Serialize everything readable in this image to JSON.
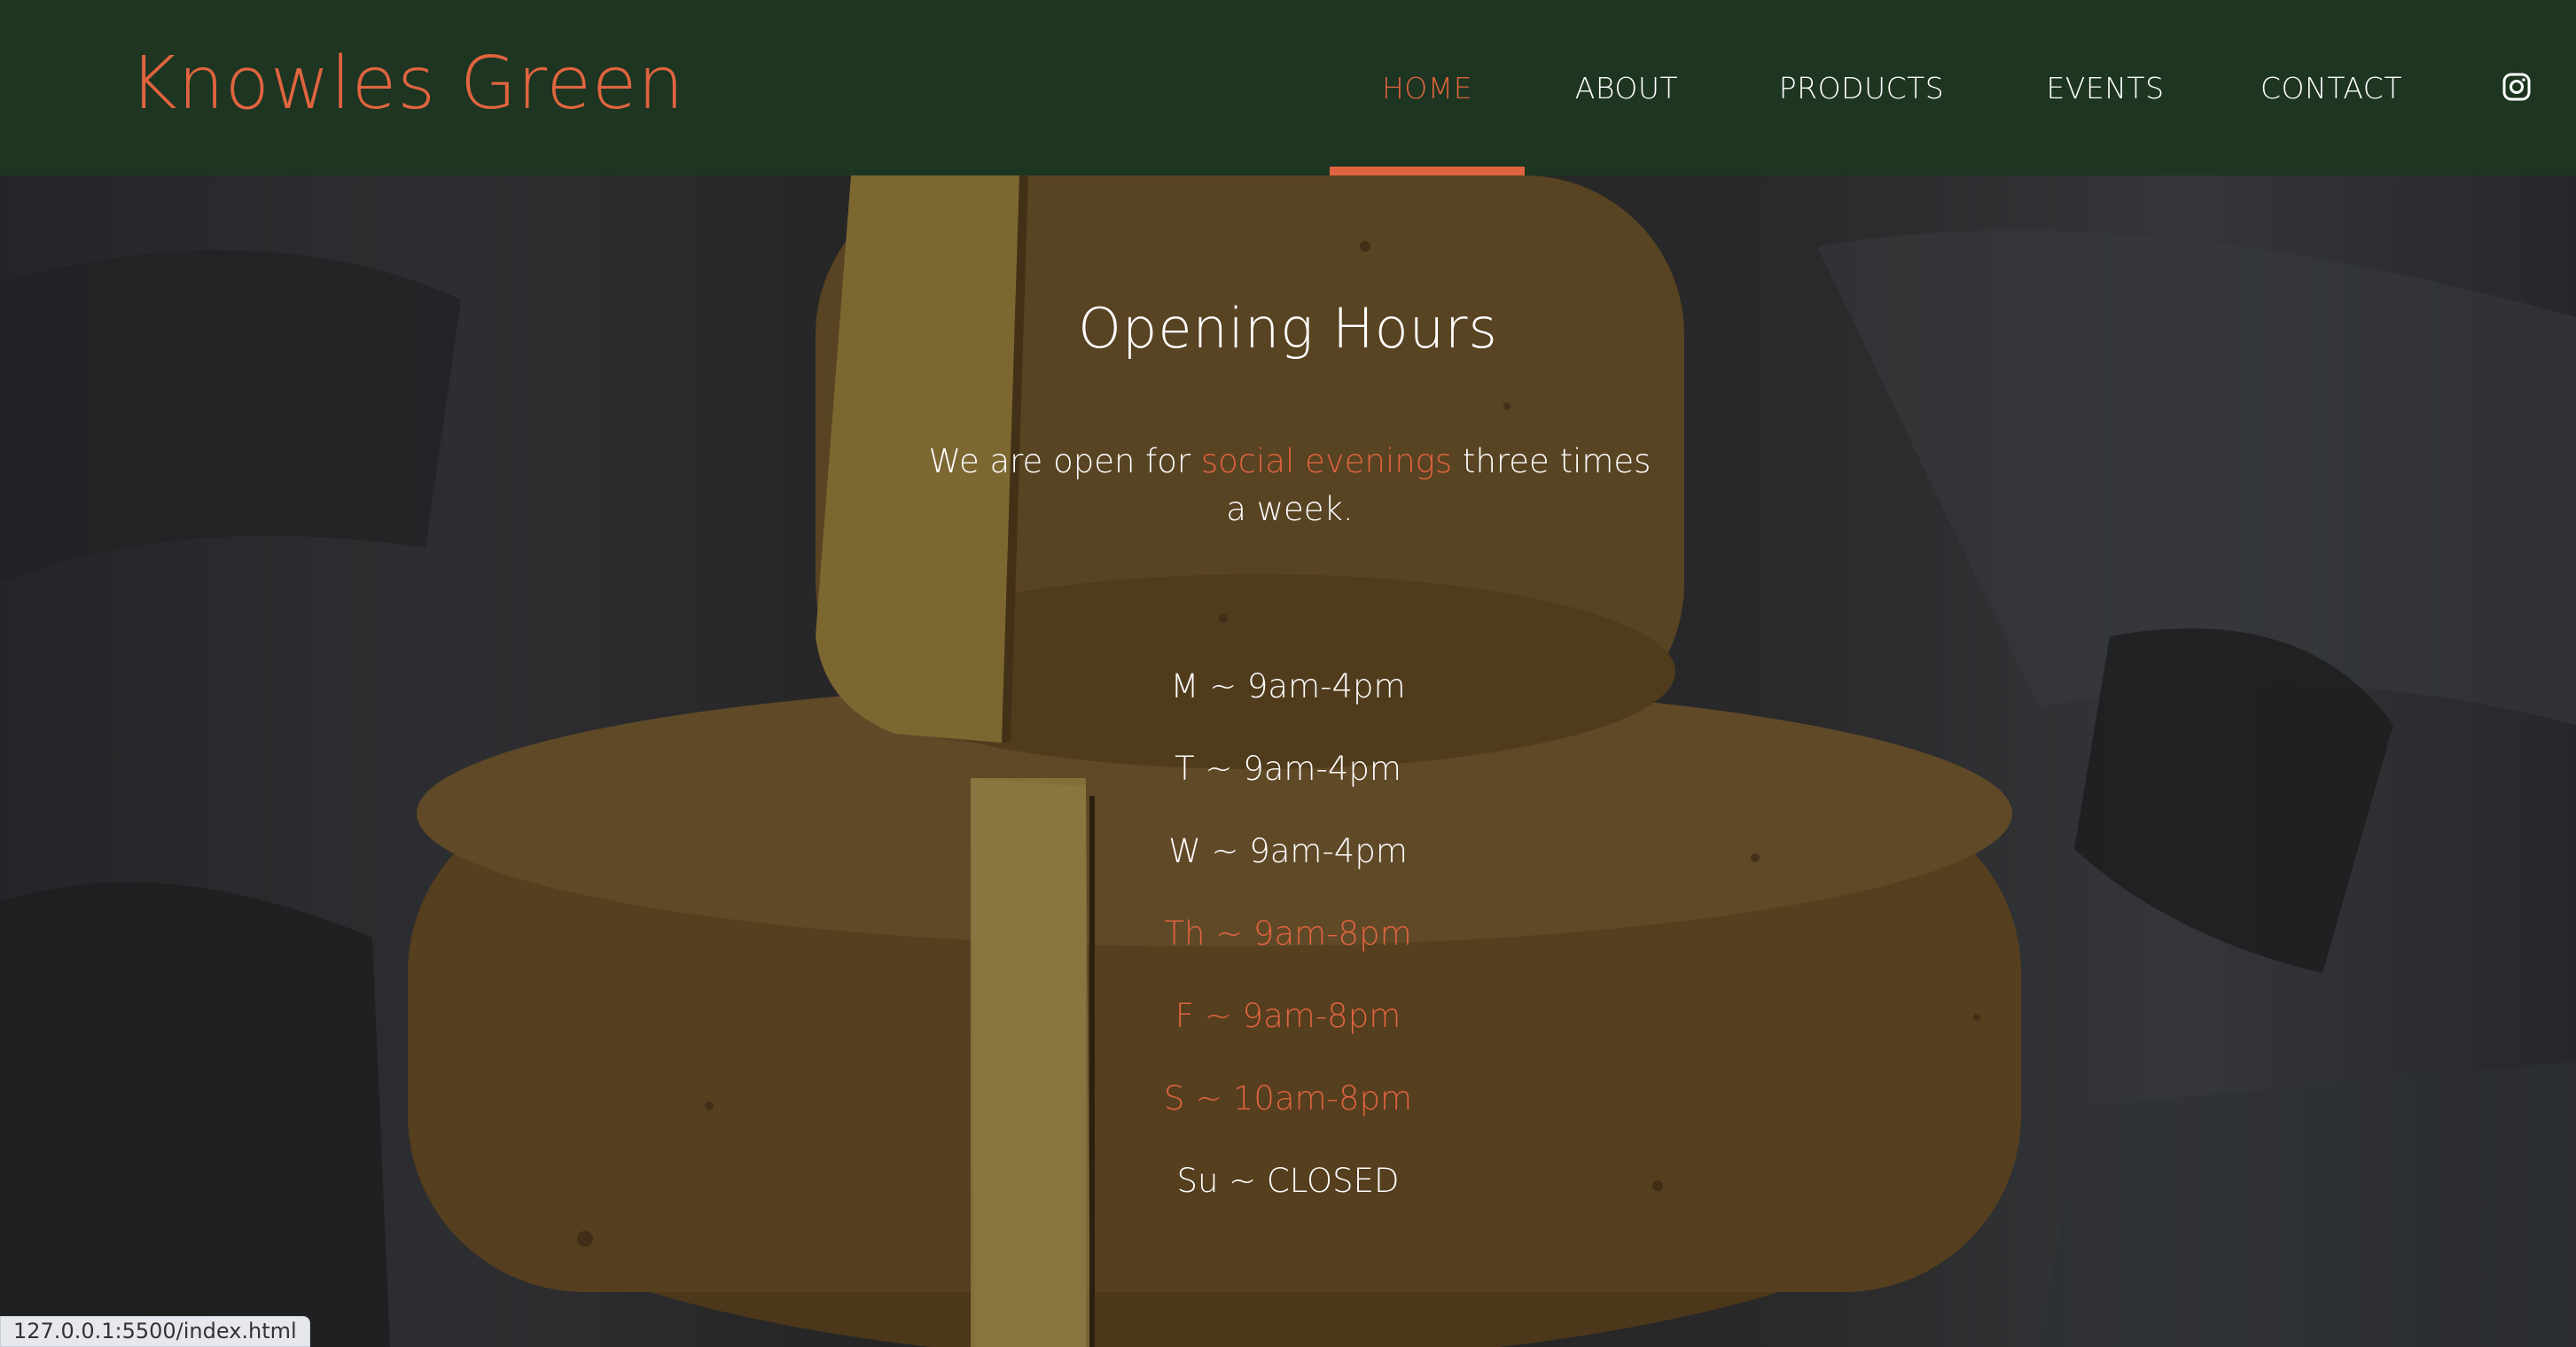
{
  "header": {
    "brand": "Knowles Green",
    "nav": [
      {
        "label": "HOME",
        "active": true
      },
      {
        "label": "ABOUT",
        "active": false
      },
      {
        "label": "PRODUCTS",
        "active": false
      },
      {
        "label": "EVENTS",
        "active": false
      },
      {
        "label": "CONTACT",
        "active": false
      }
    ],
    "social_icon": "instagram-icon"
  },
  "hero": {
    "title": "Opening Hours",
    "intro_before": "We are open for ",
    "intro_accent": "social evenings",
    "intro_after": " three times a week.",
    "hours": [
      {
        "text": "M ~ 9am-4pm",
        "highlight": false
      },
      {
        "text": "T ~ 9am-4pm",
        "highlight": false
      },
      {
        "text": "W ~ 9am-4pm",
        "highlight": false
      },
      {
        "text": "Th ~ 9am-8pm",
        "highlight": true
      },
      {
        "text": "F ~ 9am-8pm",
        "highlight": true
      },
      {
        "text": "S ~ 10am-8pm",
        "highlight": true
      },
      {
        "text": "Su ~ CLOSED",
        "highlight": false
      }
    ]
  },
  "status_bar": {
    "url": "127.0.0.1:5500/index.html"
  },
  "colors": {
    "header_bg": "#1d3521",
    "accent": "#e0643f",
    "text": "#ffffff"
  }
}
